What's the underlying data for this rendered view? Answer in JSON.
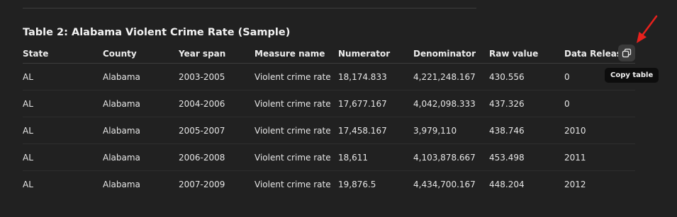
{
  "table": {
    "title": "Table 2: Alabama Violent Crime Rate (Sample)",
    "headers": [
      "State",
      "County",
      "Year span",
      "Measure name",
      "Numerator",
      "Denominator",
      "Raw value",
      "Data Release Y"
    ],
    "rows": [
      [
        "AL",
        "Alabama",
        "2003-2005",
        "Violent crime rate",
        "18,174.833",
        "4,221,248.167",
        "430.556",
        "0"
      ],
      [
        "AL",
        "Alabama",
        "2004-2006",
        "Violent crime rate",
        "17,677.167",
        "4,042,098.333",
        "437.326",
        "0"
      ],
      [
        "AL",
        "Alabama",
        "2005-2007",
        "Violent crime rate",
        "17,458.167",
        "3,979,110",
        "438.746",
        "2010"
      ],
      [
        "AL",
        "Alabama",
        "2006-2008",
        "Violent crime rate",
        "18,611",
        "4,103,878.667",
        "453.498",
        "2011"
      ],
      [
        "AL",
        "Alabama",
        "2007-2009",
        "Violent crime rate",
        "19,876.5",
        "4,434,700.167",
        "448.204",
        "2012"
      ]
    ]
  },
  "copy_button": {
    "icon": "copy-icon",
    "tooltip": "Copy table"
  },
  "annotation": {
    "icon": "red-arrow-icon",
    "color": "#e8211d"
  },
  "colors": {
    "background": "#212121",
    "text": "#ececec",
    "tooltip_bg": "#0d0d0d"
  }
}
